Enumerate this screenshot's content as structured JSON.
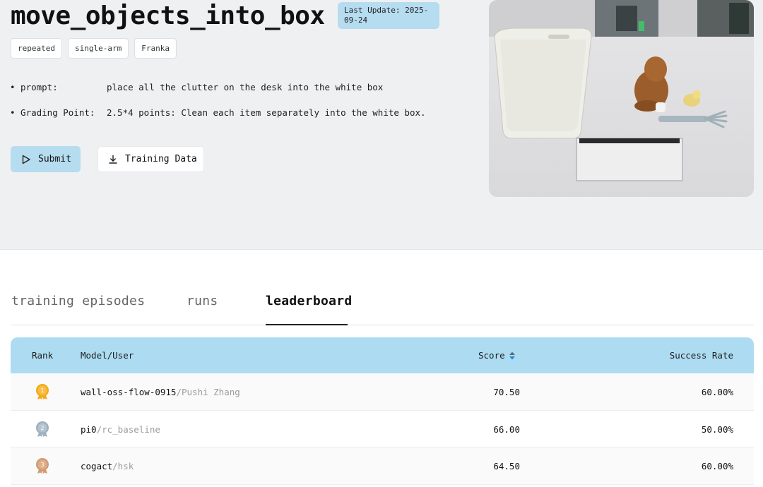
{
  "task": {
    "title": "move_objects_into_box",
    "last_update": "Last Update: 2025-09-24",
    "tags": [
      "repeated",
      "single-arm",
      "Franka"
    ],
    "prompt_label": "• prompt:",
    "prompt_value": "place all the clutter on the desk into the white box",
    "grading_label": "• Grading Point:",
    "grading_value": "2.5*4 points: Clean each item separately into the white box."
  },
  "actions": {
    "submit_label": "Submit",
    "submit_icon": "play-outline-icon",
    "training_label": "Training Data",
    "training_icon": "download-icon"
  },
  "tabs": [
    {
      "label": "training episodes",
      "active": false
    },
    {
      "label": "runs",
      "active": false
    },
    {
      "label": "leaderboard",
      "active": true
    }
  ],
  "leaderboard": {
    "headers": {
      "rank": "Rank",
      "model": "Model/User",
      "score": "Score",
      "success": "Success Rate"
    },
    "rows": [
      {
        "rank": "1",
        "model": "wall-oss-flow-0915",
        "user": "/Pushi Zhang",
        "score": "70.50",
        "success": "60.00%",
        "medal_color": "#f4a91c"
      },
      {
        "rank": "2",
        "model": "pi0",
        "user": "/rc_baseline",
        "score": "66.00",
        "success": "50.00%",
        "medal_color": "#9fb0c0"
      },
      {
        "rank": "3",
        "model": "cogact",
        "user": "/hsk",
        "score": "64.50",
        "success": "60.00%",
        "medal_color": "#d39a72"
      }
    ]
  },
  "colors": {
    "accent": "#b6dcf0",
    "header_bg": "#addcf2",
    "top_bg": "#eff0f2"
  }
}
